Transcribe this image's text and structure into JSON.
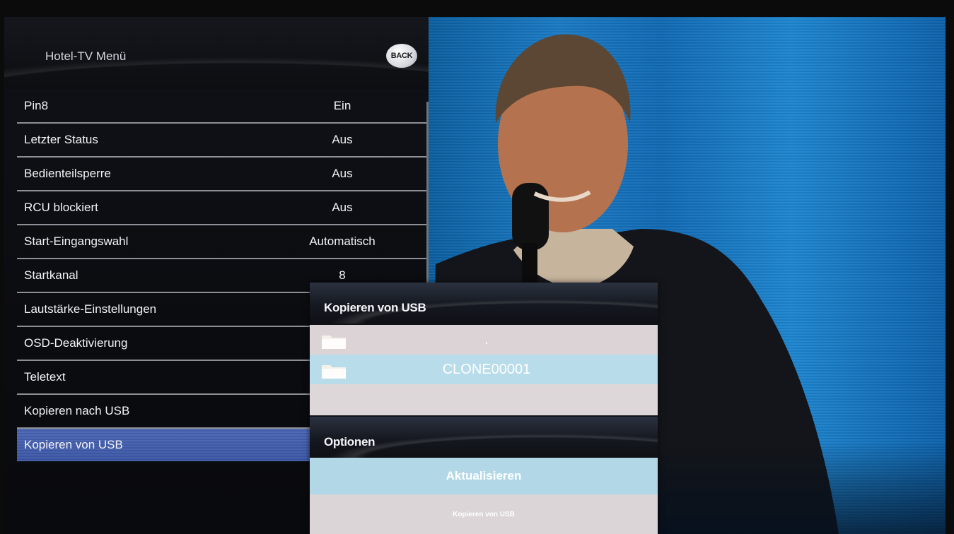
{
  "menu": {
    "title": "Hotel-TV Menü",
    "back_label": "BACK",
    "items": [
      {
        "label": "Pin8",
        "value": "Ein"
      },
      {
        "label": "Letzter Status",
        "value": "Aus"
      },
      {
        "label": "Bedienteilsperre",
        "value": "Aus"
      },
      {
        "label": "RCU blockiert",
        "value": "Aus"
      },
      {
        "label": "Start-Eingangswahl",
        "value": "Automatisch"
      },
      {
        "label": "Startkanal",
        "value": "8"
      },
      {
        "label": "Lautstärke-Einstellungen",
        "value": ""
      },
      {
        "label": "OSD-Deaktivierung",
        "value": ""
      },
      {
        "label": "Teletext",
        "value": ""
      },
      {
        "label": "Kopieren nach USB",
        "value": ""
      },
      {
        "label": "Kopieren von USB",
        "value": ""
      }
    ],
    "selected_index": 10
  },
  "popup": {
    "title": "Kopieren von USB",
    "files": [
      {
        "icon": "folder-icon",
        "name": "."
      },
      {
        "icon": "folder-icon",
        "name": "CLONE00001"
      }
    ],
    "options_title": "Optionen",
    "options": [
      {
        "label": "Aktualisieren"
      },
      {
        "label": "Kopieren von USB"
      }
    ]
  },
  "colors": {
    "selected_row": "#3f5aa9",
    "highlight_row": "#b8dcea",
    "video_blue": "#1b7bc4"
  }
}
